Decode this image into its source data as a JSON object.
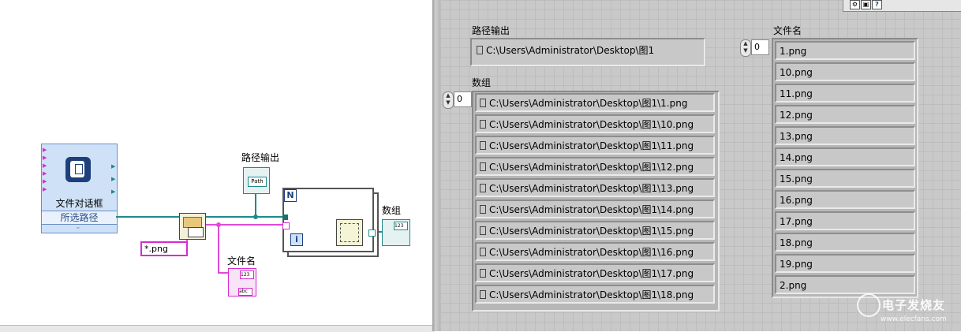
{
  "block_diagram": {
    "file_dialog": {
      "title": "文件对话框",
      "output": "所选路径"
    },
    "path_out_label": "路径输出",
    "path_terminal_text": "Path",
    "pattern_constant": "*.png",
    "filename_label": "文件名",
    "array_label": "数组",
    "loop_count_symbol": "N",
    "loop_index_symbol": "i",
    "terminal_num_text": "123",
    "terminal_str_text": "abc"
  },
  "front_panel": {
    "path_out": {
      "label": "路径输出",
      "value": "C:\\Users\\Administrator\\Desktop\\图1"
    },
    "array": {
      "label": "数组",
      "index": "0",
      "items": [
        "C:\\Users\\Administrator\\Desktop\\图1\\1.png",
        "C:\\Users\\Administrator\\Desktop\\图1\\10.png",
        "C:\\Users\\Administrator\\Desktop\\图1\\11.png",
        "C:\\Users\\Administrator\\Desktop\\图1\\12.png",
        "C:\\Users\\Administrator\\Desktop\\图1\\13.png",
        "C:\\Users\\Administrator\\Desktop\\图1\\14.png",
        "C:\\Users\\Administrator\\Desktop\\图1\\15.png",
        "C:\\Users\\Administrator\\Desktop\\图1\\16.png",
        "C:\\Users\\Administrator\\Desktop\\图1\\17.png",
        "C:\\Users\\Administrator\\Desktop\\图1\\18.png"
      ]
    },
    "filenames": {
      "label": "文件名",
      "index": "0",
      "items": [
        "1.png",
        "10.png",
        "11.png",
        "12.png",
        "13.png",
        "14.png",
        "15.png",
        "16.png",
        "17.png",
        "18.png",
        "19.png",
        "2.png"
      ]
    }
  },
  "toolbar": {
    "help_label": "?"
  },
  "watermark": {
    "line1": "电子发烧友",
    "line2": "www.elecfans.com"
  },
  "colors": {
    "path_wire": "#1f8a8a",
    "string_wire": "#e04ad8",
    "panel_bg": "#c9c9c9"
  }
}
